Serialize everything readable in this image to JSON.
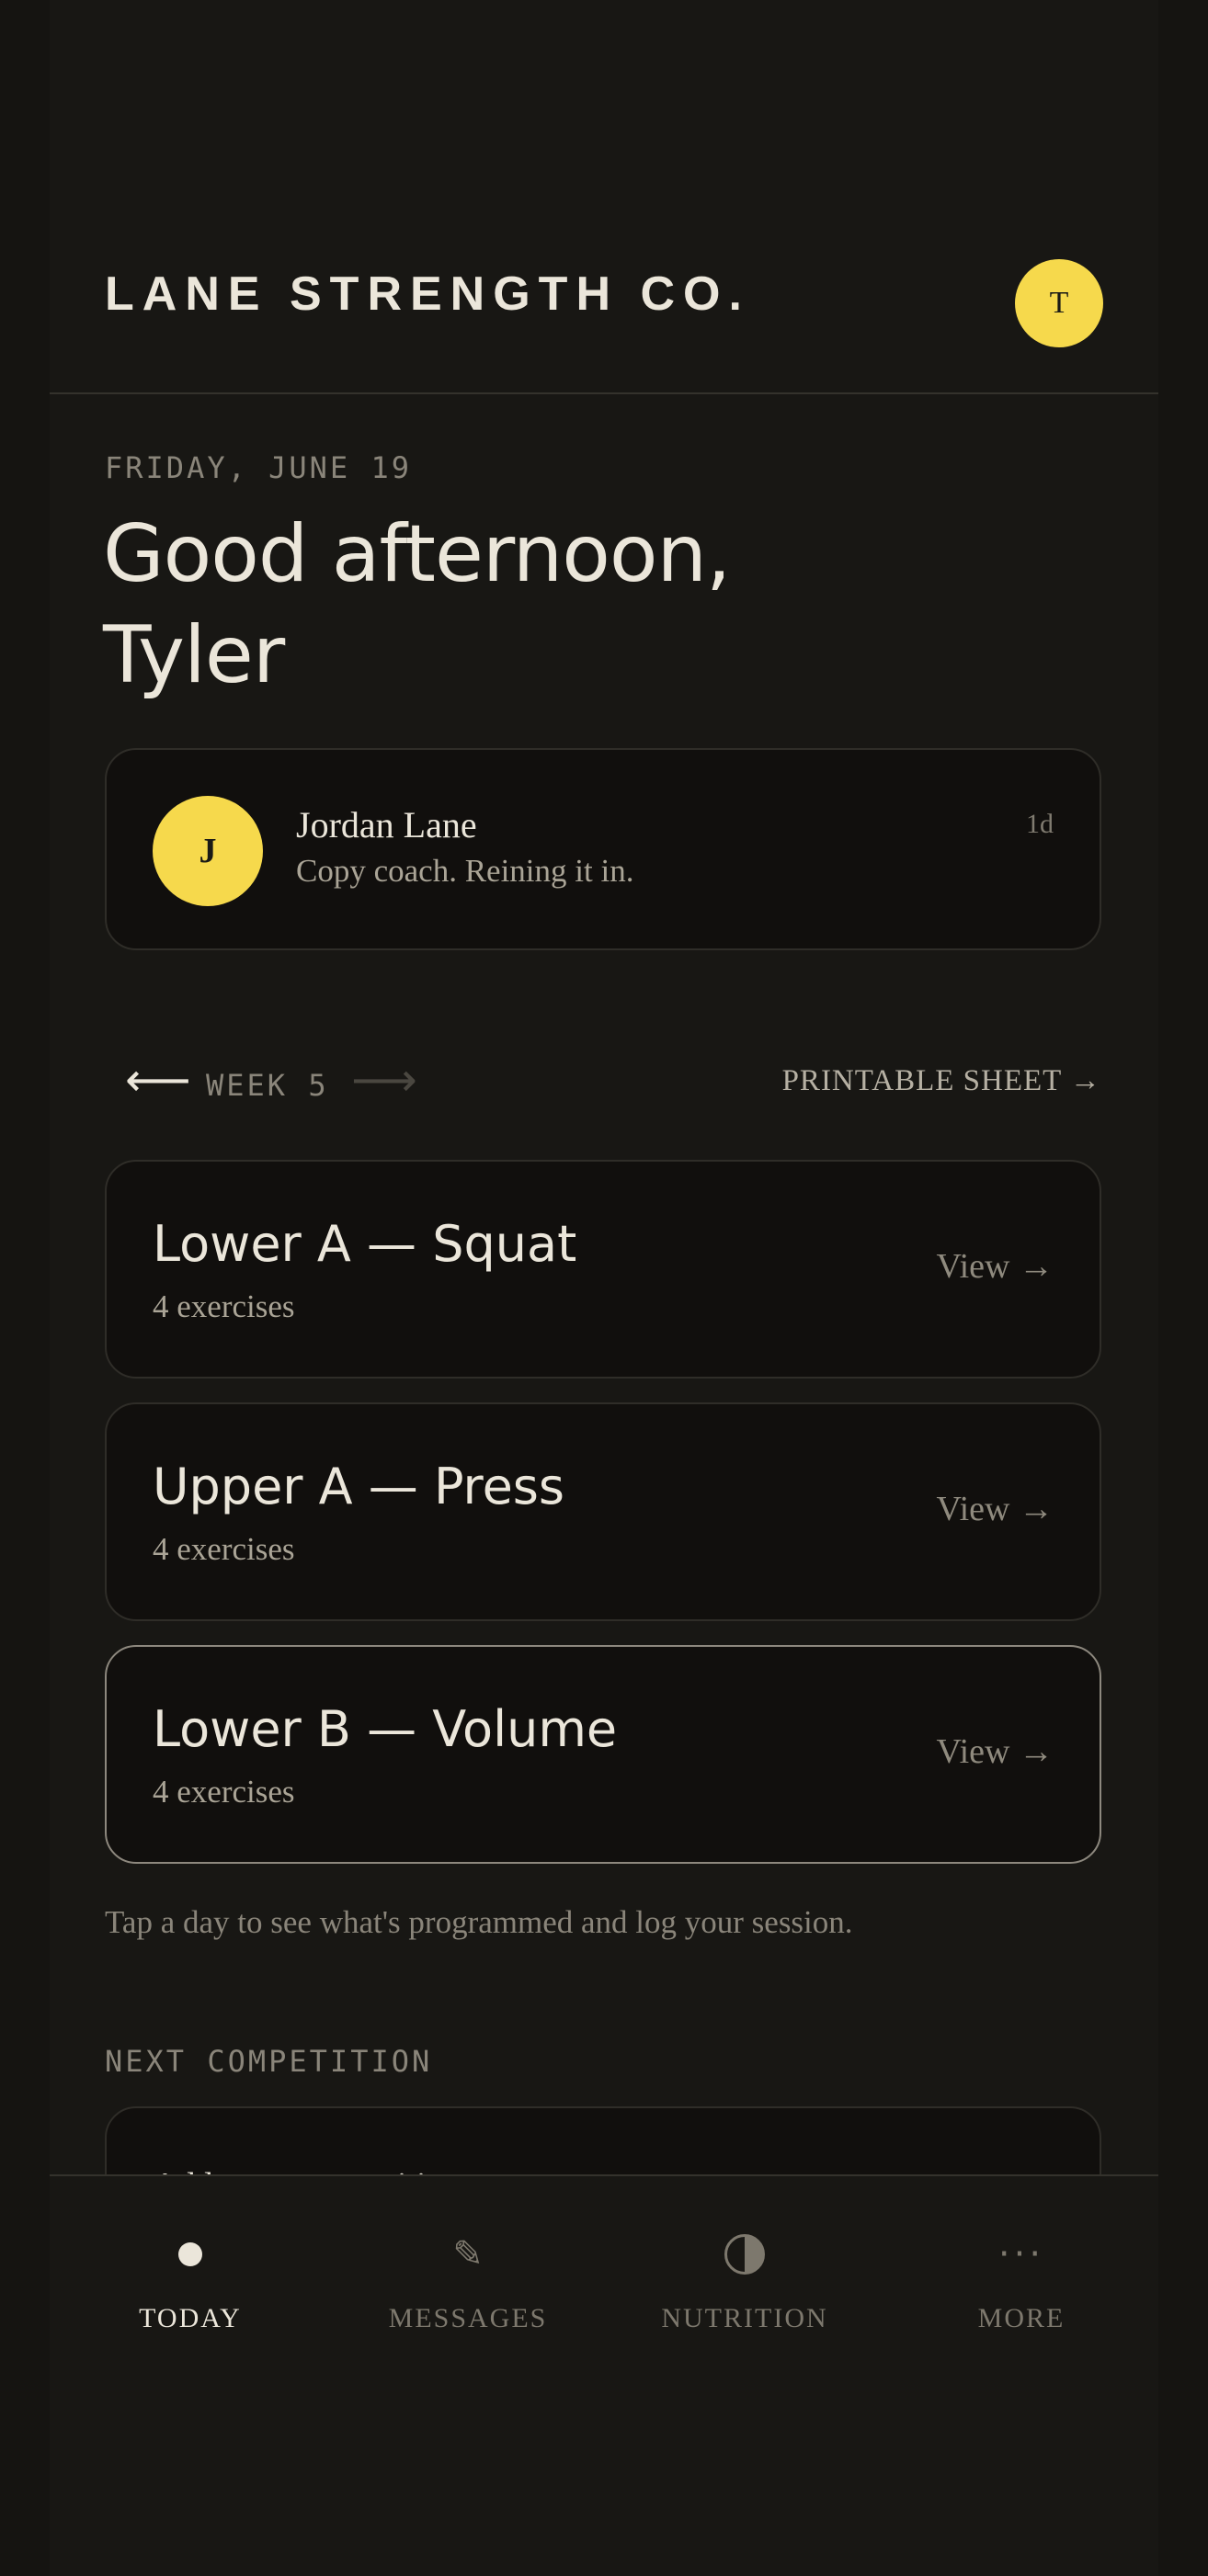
{
  "header": {
    "brand": "LANE STRENGTH CO.",
    "avatar_initial": "T"
  },
  "greeting": {
    "date": "FRIDAY, JUNE 19",
    "line1": "Good afternoon,",
    "line2": "Tyler"
  },
  "message": {
    "avatar_initial": "J",
    "sender": "Jordan Lane",
    "preview": "Copy coach. Reining it in.",
    "time": "1d"
  },
  "week_nav": {
    "prev_icon": "arrow-left",
    "label": "WEEK 5",
    "next_icon": "arrow-right",
    "printable": "PRINTABLE SHEET →"
  },
  "sessions": [
    {
      "title": "Lower A — Squat",
      "subtitle": "4 exercises",
      "action": "View →"
    },
    {
      "title": "Upper A — Press",
      "subtitle": "4 exercises",
      "action": "View →"
    },
    {
      "title": "Lower B — Volume",
      "subtitle": "4 exercises",
      "action": "View →"
    }
  ],
  "hint": "Tap a day to see what's programmed and log your session.",
  "competition": {
    "label": "NEXT COMPETITION",
    "text": "Add your competition"
  },
  "tabs": [
    {
      "label": "TODAY",
      "icon": "dot-icon",
      "active": true
    },
    {
      "label": "MESSAGES",
      "icon": "pencil-icon",
      "active": false
    },
    {
      "label": "NUTRITION",
      "icon": "half-circle-icon",
      "active": false
    },
    {
      "label": "MORE",
      "icon": "more-dots-icon",
      "active": false
    }
  ],
  "colors": {
    "background": "#181714",
    "card": "#110f0d",
    "accent": "#f6d94c",
    "text": "#ebe6da",
    "muted": "#8a857a"
  }
}
